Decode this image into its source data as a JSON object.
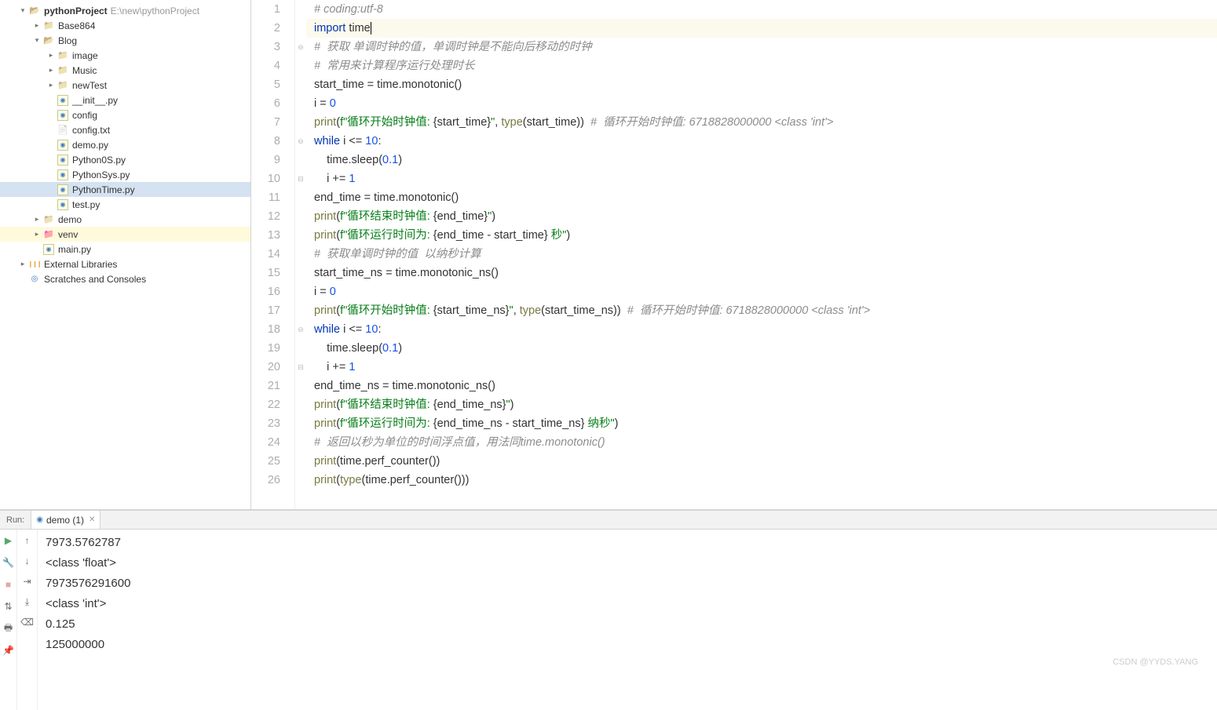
{
  "project": {
    "name": "pythonProject",
    "path": "E:\\new\\pythonProject"
  },
  "tree": [
    {
      "depth": 0,
      "chev": "▾",
      "icon": "folder-o",
      "label": "pythonProject",
      "bold": true,
      "hint": "E:\\new\\pythonProject"
    },
    {
      "depth": 1,
      "chev": "▸",
      "icon": "folder-c",
      "label": "Base864"
    },
    {
      "depth": 1,
      "chev": "▾",
      "icon": "folder-o",
      "label": "Blog"
    },
    {
      "depth": 2,
      "chev": "▸",
      "icon": "folder-c",
      "label": "image"
    },
    {
      "depth": 2,
      "chev": "▸",
      "icon": "folder-c",
      "label": "Music"
    },
    {
      "depth": 2,
      "chev": "▸",
      "icon": "folder-c",
      "label": "newTest"
    },
    {
      "depth": 2,
      "chev": "",
      "icon": "pyfile",
      "label": "__init__.py"
    },
    {
      "depth": 2,
      "chev": "",
      "icon": "pyfile",
      "label": "config"
    },
    {
      "depth": 2,
      "chev": "",
      "icon": "txtfile",
      "label": "config.txt"
    },
    {
      "depth": 2,
      "chev": "",
      "icon": "pyfile",
      "label": "demo.py"
    },
    {
      "depth": 2,
      "chev": "",
      "icon": "pyfile",
      "label": "Python0S.py"
    },
    {
      "depth": 2,
      "chev": "",
      "icon": "pyfile",
      "label": "PythonSys.py"
    },
    {
      "depth": 2,
      "chev": "",
      "icon": "pyfile",
      "label": "PythonTime.py",
      "selected": true
    },
    {
      "depth": 2,
      "chev": "",
      "icon": "pyfile",
      "label": "test.py"
    },
    {
      "depth": 1,
      "chev": "▸",
      "icon": "folder-c",
      "label": "demo"
    },
    {
      "depth": 1,
      "chev": "▸",
      "icon": "folder-v",
      "label": "venv",
      "venv": true
    },
    {
      "depth": 1,
      "chev": "",
      "icon": "pyfile",
      "label": "main.py"
    },
    {
      "depth": 0,
      "chev": "▸",
      "icon": "lib",
      "label": "External Libraries"
    },
    {
      "depth": 0,
      "chev": "",
      "icon": "scratch",
      "label": "Scratches and Consoles"
    }
  ],
  "code": [
    {
      "n": 1,
      "fold": "",
      "segs": [
        {
          "t": "# coding:utf-8",
          "c": "comment"
        }
      ]
    },
    {
      "n": 2,
      "fold": "",
      "hl": true,
      "segs": [
        {
          "t": "import ",
          "c": "kw"
        },
        {
          "t": "time",
          "c": "",
          "cursor": true
        }
      ]
    },
    {
      "n": 3,
      "fold": "⊖",
      "segs": [
        {
          "t": "#  获取 单调时钟的值，单调时钟是不能向后移动的时钟",
          "c": "comment"
        }
      ]
    },
    {
      "n": 4,
      "fold": "",
      "segs": [
        {
          "t": "#  常用来计算程序运行处理时长",
          "c": "comment"
        }
      ]
    },
    {
      "n": 5,
      "fold": "",
      "segs": [
        {
          "t": "start_time = time.monotonic()",
          "c": ""
        }
      ]
    },
    {
      "n": 6,
      "fold": "",
      "segs": [
        {
          "t": "i = ",
          "c": ""
        },
        {
          "t": "0",
          "c": "num"
        }
      ]
    },
    {
      "n": 7,
      "fold": "",
      "segs": [
        {
          "t": "print",
          "c": "fn"
        },
        {
          "t": "(",
          "c": ""
        },
        {
          "t": "f\"循环开始时钟值: ",
          "c": "str"
        },
        {
          "t": "{start_time}",
          "c": ""
        },
        {
          "t": "\"",
          "c": "str"
        },
        {
          "t": ", ",
          "c": ""
        },
        {
          "t": "type",
          "c": "fn"
        },
        {
          "t": "(start_time))  ",
          "c": ""
        },
        {
          "t": "#  循环开始时钟值: 6718828000000 <class 'int'>",
          "c": "comment"
        }
      ]
    },
    {
      "n": 8,
      "fold": "⊖",
      "segs": [
        {
          "t": "while ",
          "c": "kw"
        },
        {
          "t": "i <= ",
          "c": ""
        },
        {
          "t": "10",
          "c": "num"
        },
        {
          "t": ":",
          "c": ""
        }
      ]
    },
    {
      "n": 9,
      "fold": "",
      "segs": [
        {
          "t": "    time.sleep(",
          "c": ""
        },
        {
          "t": "0.1",
          "c": "num"
        },
        {
          "t": ")",
          "c": ""
        }
      ]
    },
    {
      "n": 10,
      "fold": "⊟",
      "segs": [
        {
          "t": "    i += ",
          "c": ""
        },
        {
          "t": "1",
          "c": "num"
        }
      ]
    },
    {
      "n": 11,
      "fold": "",
      "segs": [
        {
          "t": "end_time = time.monotonic()",
          "c": ""
        }
      ]
    },
    {
      "n": 12,
      "fold": "",
      "segs": [
        {
          "t": "print",
          "c": "fn"
        },
        {
          "t": "(",
          "c": ""
        },
        {
          "t": "f\"循环结束时钟值: ",
          "c": "str"
        },
        {
          "t": "{end_time}",
          "c": ""
        },
        {
          "t": "\"",
          "c": "str"
        },
        {
          "t": ")",
          "c": ""
        }
      ]
    },
    {
      "n": 13,
      "fold": "",
      "segs": [
        {
          "t": "print",
          "c": "fn"
        },
        {
          "t": "(",
          "c": ""
        },
        {
          "t": "f\"循环运行时间为: ",
          "c": "str"
        },
        {
          "t": "{end_time - start_time}",
          "c": ""
        },
        {
          "t": " 秒\"",
          "c": "str"
        },
        {
          "t": ")",
          "c": ""
        }
      ]
    },
    {
      "n": 14,
      "fold": "",
      "segs": [
        {
          "t": "#  获取单调时钟的值  以纳秒计算",
          "c": "comment"
        }
      ]
    },
    {
      "n": 15,
      "fold": "",
      "segs": [
        {
          "t": "start_time_ns = time.monotonic_ns()",
          "c": ""
        }
      ]
    },
    {
      "n": 16,
      "fold": "",
      "segs": [
        {
          "t": "i = ",
          "c": ""
        },
        {
          "t": "0",
          "c": "num"
        }
      ]
    },
    {
      "n": 17,
      "fold": "",
      "segs": [
        {
          "t": "print",
          "c": "fn"
        },
        {
          "t": "(",
          "c": ""
        },
        {
          "t": "f\"循环开始时钟值: ",
          "c": "str"
        },
        {
          "t": "{start_time_ns}",
          "c": ""
        },
        {
          "t": "\"",
          "c": "str"
        },
        {
          "t": ", ",
          "c": ""
        },
        {
          "t": "type",
          "c": "fn"
        },
        {
          "t": "(start_time_ns))  ",
          "c": ""
        },
        {
          "t": "#  循环开始时钟值: 6718828000000 <class 'int'>",
          "c": "comment"
        }
      ]
    },
    {
      "n": 18,
      "fold": "⊖",
      "segs": [
        {
          "t": "while ",
          "c": "kw"
        },
        {
          "t": "i <= ",
          "c": ""
        },
        {
          "t": "10",
          "c": "num"
        },
        {
          "t": ":",
          "c": ""
        }
      ]
    },
    {
      "n": 19,
      "fold": "",
      "segs": [
        {
          "t": "    time.sleep(",
          "c": ""
        },
        {
          "t": "0.1",
          "c": "num"
        },
        {
          "t": ")",
          "c": ""
        }
      ]
    },
    {
      "n": 20,
      "fold": "⊟",
      "segs": [
        {
          "t": "    i += ",
          "c": ""
        },
        {
          "t": "1",
          "c": "num"
        }
      ]
    },
    {
      "n": 21,
      "fold": "",
      "segs": [
        {
          "t": "end_time_ns = time.monotonic_ns()",
          "c": ""
        }
      ]
    },
    {
      "n": 22,
      "fold": "",
      "segs": [
        {
          "t": "print",
          "c": "fn"
        },
        {
          "t": "(",
          "c": ""
        },
        {
          "t": "f\"循环结束时钟值: ",
          "c": "str"
        },
        {
          "t": "{end_time_ns}",
          "c": ""
        },
        {
          "t": "\"",
          "c": "str"
        },
        {
          "t": ")",
          "c": ""
        }
      ]
    },
    {
      "n": 23,
      "fold": "",
      "segs": [
        {
          "t": "print",
          "c": "fn"
        },
        {
          "t": "(",
          "c": ""
        },
        {
          "t": "f\"循环运行时间为: ",
          "c": "str"
        },
        {
          "t": "{end_time_ns - start_time_ns}",
          "c": ""
        },
        {
          "t": " 纳秒\"",
          "c": "str"
        },
        {
          "t": ")",
          "c": ""
        }
      ]
    },
    {
      "n": 24,
      "fold": "",
      "segs": [
        {
          "t": "#  返回以秒为单位的时间浮点值，用法同time.monotonic()",
          "c": "comment"
        }
      ]
    },
    {
      "n": 25,
      "fold": "",
      "segs": [
        {
          "t": "print",
          "c": "fn"
        },
        {
          "t": "(time.perf_counter())",
          "c": ""
        }
      ]
    },
    {
      "n": 26,
      "fold": "",
      "segs": [
        {
          "t": "print",
          "c": "fn"
        },
        {
          "t": "(",
          "c": ""
        },
        {
          "t": "type",
          "c": "fn"
        },
        {
          "t": "(time.perf_counter()))",
          "c": ""
        }
      ]
    }
  ],
  "run": {
    "label": "Run:",
    "tab": "demo (1)",
    "output": [
      "7973.5762787",
      "<class 'float'>",
      "7973576291600",
      "<class 'int'>",
      "0.125",
      "125000000"
    ]
  },
  "watermark": "CSDN @YYDS.YANG"
}
